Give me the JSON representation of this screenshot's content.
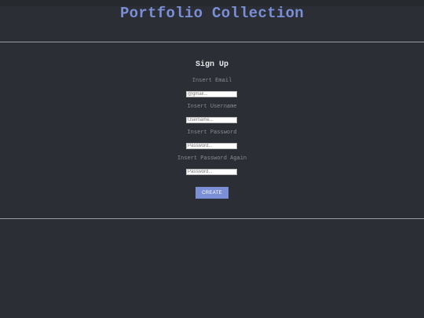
{
  "header": {
    "title": "Portfolio Collection"
  },
  "signup": {
    "title": "Sign Up",
    "email_label": "Insert Email",
    "email_placeholder": "@gmail...",
    "username_label": "Insert Username",
    "username_placeholder": "Username...",
    "password_label": "Insert Password",
    "password_placeholder": "Password...",
    "password_again_label": "Insert Password Again",
    "password_again_placeholder": "Password...",
    "create_label": "CREATE"
  },
  "colors": {
    "background": "#2b2e34",
    "accent": "#7a8fd6",
    "divider": "#9a9da3",
    "label": "#8a8d93"
  }
}
